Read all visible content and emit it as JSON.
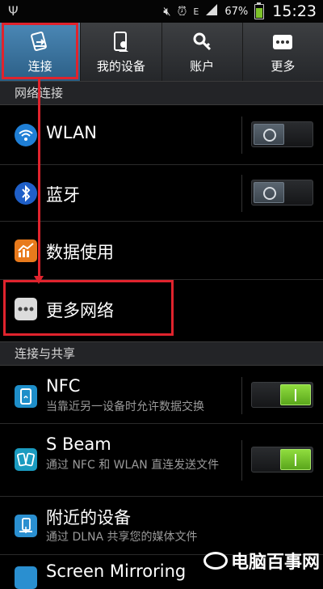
{
  "status_bar": {
    "usb_icon": "usb-icon",
    "battery_percent": "67%",
    "time": "15:23",
    "network_letter": "E"
  },
  "tabs": [
    {
      "label": "连接",
      "icon": "connections-icon",
      "active": true
    },
    {
      "label": "我的设备",
      "icon": "my-device-icon",
      "active": false
    },
    {
      "label": "账户",
      "icon": "accounts-icon",
      "active": false
    },
    {
      "label": "更多",
      "icon": "more-icon",
      "active": false
    }
  ],
  "sections": {
    "network": "网络连接",
    "sharing": "连接与共享"
  },
  "items": {
    "wlan": {
      "title": "WLAN",
      "switch": "off"
    },
    "bluetooth": {
      "title": "蓝牙",
      "switch": "off"
    },
    "data_usage": {
      "title": "数据使用"
    },
    "more_networks": {
      "title": "更多网络"
    },
    "nfc": {
      "title": "NFC",
      "subtitle": "当靠近另一设备时允许数据交换",
      "switch": "on"
    },
    "sbeam": {
      "title": "S Beam",
      "subtitle": "通过 NFC 和 WLAN 直连发送文件",
      "switch": "on"
    },
    "nearby": {
      "title": "附近的设备",
      "subtitle": "通过 DLNA 共享您的媒体文件"
    },
    "mirroring": {
      "title": "Screen Mirroring"
    }
  },
  "watermark": {
    "text": "电脑百事网"
  },
  "colors": {
    "highlight": "#e0232d",
    "active_tab": "#3b7aa8",
    "switch_on": "#7cc92f"
  }
}
